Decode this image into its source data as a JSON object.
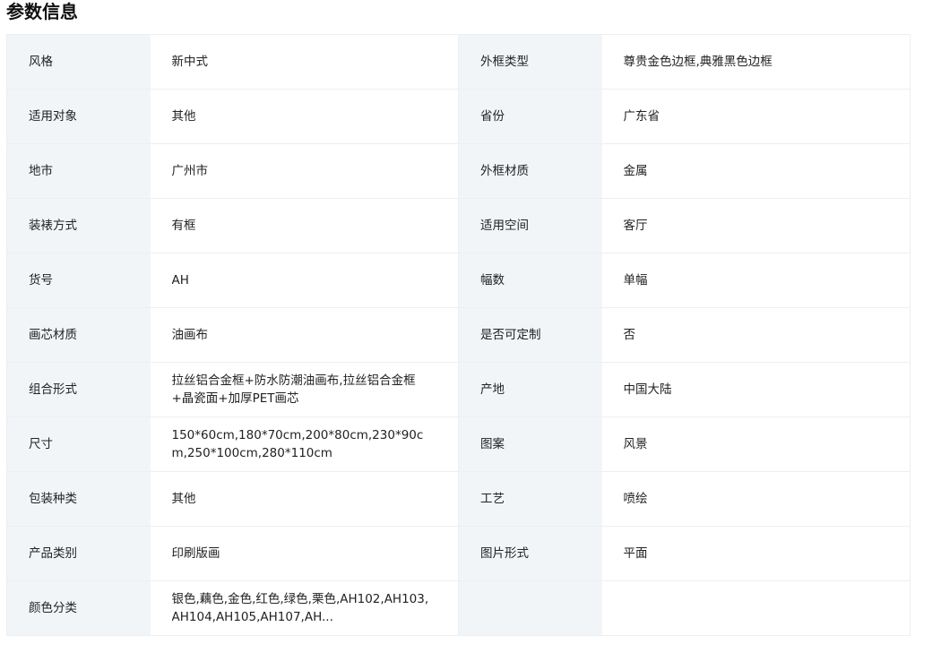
{
  "section": {
    "title": "参数信息"
  },
  "rows": [
    {
      "left": {
        "label": "风格",
        "value": "新中式"
      },
      "right": {
        "label": "外框类型",
        "value": "尊贵金色边框,典雅黑色边框"
      }
    },
    {
      "left": {
        "label": "适用对象",
        "value": "其他"
      },
      "right": {
        "label": "省份",
        "value": "广东省"
      }
    },
    {
      "left": {
        "label": "地市",
        "value": "广州市"
      },
      "right": {
        "label": "外框材质",
        "value": "金属"
      }
    },
    {
      "left": {
        "label": "装裱方式",
        "value": "有框"
      },
      "right": {
        "label": "适用空间",
        "value": "客厅"
      }
    },
    {
      "left": {
        "label": "货号",
        "value": "AH"
      },
      "right": {
        "label": "幅数",
        "value": "单幅"
      }
    },
    {
      "left": {
        "label": "画芯材质",
        "value": "油画布"
      },
      "right": {
        "label": "是否可定制",
        "value": "否"
      }
    },
    {
      "left": {
        "label": "组合形式",
        "value": "拉丝铝合金框+防水防潮油画布,拉丝铝合金框+晶瓷面+加厚PET画芯"
      },
      "right": {
        "label": "产地",
        "value": "中国大陆"
      }
    },
    {
      "left": {
        "label": "尺寸",
        "value": "150*60cm,180*70cm,200*80cm,230*90cm,250*100cm,280*110cm"
      },
      "right": {
        "label": "图案",
        "value": "风景"
      }
    },
    {
      "left": {
        "label": "包装种类",
        "value": "其他"
      },
      "right": {
        "label": "工艺",
        "value": "喷绘"
      }
    },
    {
      "left": {
        "label": "产品类别",
        "value": "印刷版画"
      },
      "right": {
        "label": "图片形式",
        "value": "平面"
      }
    },
    {
      "left": {
        "label": "颜色分类",
        "value": "银色,藕色,金色,红色,绿色,栗色,AH102,AH103,AH104,AH105,AH107,AH..."
      },
      "right": {
        "label": "",
        "value": ""
      }
    }
  ]
}
